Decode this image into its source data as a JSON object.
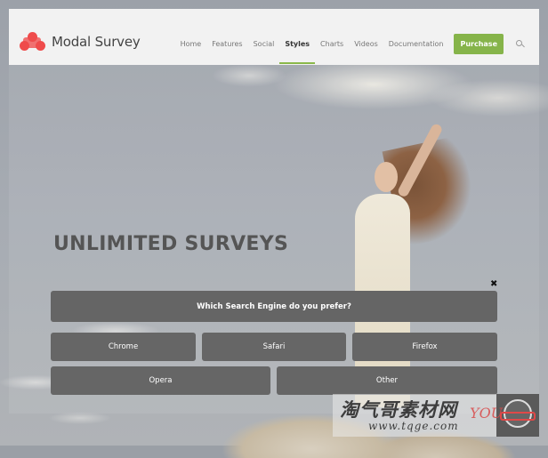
{
  "header": {
    "brand": "Modal Survey",
    "nav": [
      {
        "label": "Home",
        "active": false
      },
      {
        "label": "Features",
        "active": false
      },
      {
        "label": "Social",
        "active": false
      },
      {
        "label": "Styles",
        "active": true
      },
      {
        "label": "Charts",
        "active": false
      },
      {
        "label": "Videos",
        "active": false
      },
      {
        "label": "Documentation",
        "active": false
      }
    ],
    "purchase_label": "Purchase",
    "search_icon": "search-icon"
  },
  "hero": {
    "title": "UNLIMITED SURVEYS"
  },
  "survey": {
    "close_icon": "close-icon",
    "question": "Which Search Engine do you prefer?",
    "answers": [
      "Chrome",
      "Safari",
      "Firefox",
      "Opera",
      "Other"
    ]
  },
  "watermark": {
    "title": "淘气哥素材网",
    "url": "www.tqge.com",
    "brand": "YOU"
  },
  "colors": {
    "accent": "#86b44a",
    "logo": "#ef4b4b",
    "survey_button": "#666666"
  }
}
